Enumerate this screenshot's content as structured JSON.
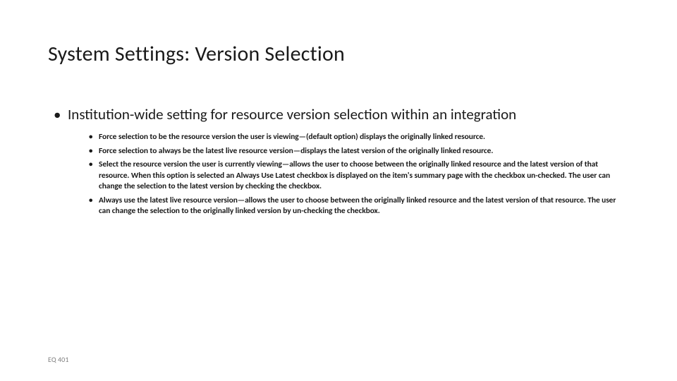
{
  "title": "System Settings: Version Selection",
  "main_bullet": "Institution-wide setting for resource version selection within an integration",
  "sub_bullets": [
    "Force selection to be the resource version the user is viewing—(default option) displays the originally linked resource.",
    "Force selection to always be the latest live resource version—displays the latest version of the originally linked resource.",
    "Select the resource version the user is currently viewing—allows the user to choose between the originally linked resource and the latest version of that resource. When this option is selected an Always Use Latest checkbox is displayed on the item's summary page with the checkbox un-checked. The user can change the selection to the latest version by checking the checkbox.",
    "Always use the latest live resource version—allows the user to choose between the originally linked resource and the latest version of that resource. The user can change the selection to the originally linked version by un-checking the checkbox."
  ],
  "footer": "EQ 401"
}
